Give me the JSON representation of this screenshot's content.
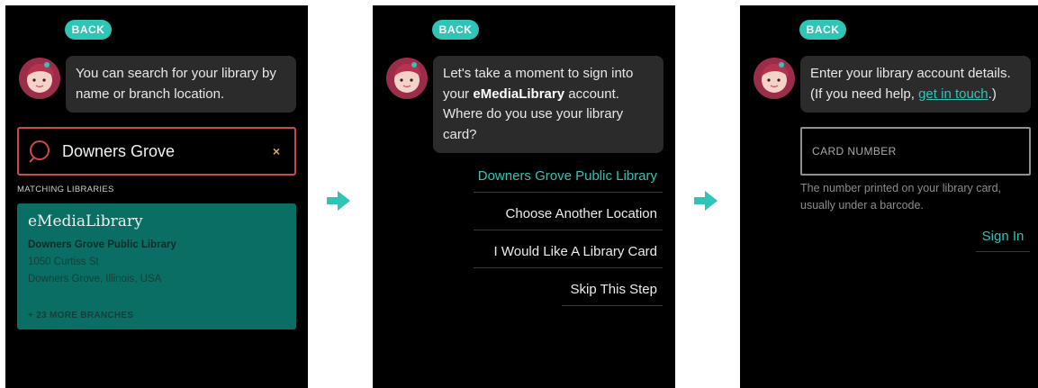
{
  "back_label": "BACK",
  "colors": {
    "accent": "#2ec4b6",
    "card": "#0b6e64",
    "error_border": "#d14848"
  },
  "screen1": {
    "bubble": "You can search for your library by name or branch location.",
    "search": {
      "value": "Downers Grove",
      "clear": "×"
    },
    "section_label": "MATCHING LIBRARIES",
    "card": {
      "brand": "eMediaLibrary",
      "name": "Downers Grove Public Library",
      "street": "1050 Curtiss St",
      "city": "Downers Grove, Illinois, USA",
      "more": "+ 23 MORE BRANCHES"
    }
  },
  "screen2": {
    "bubble_pre": "Let's take a moment to sign into your ",
    "bubble_bold": "eMediaLibrary",
    "bubble_post": " account. Where do you use your library card?",
    "options": [
      "Downers Grove Public Library",
      "Choose Another Location",
      "I Would Like A Library Card",
      "Skip This Step"
    ]
  },
  "screen3": {
    "bubble_pre": "Enter your library account details. (If you need help, ",
    "bubble_link": "get in touch",
    "bubble_post": ".)",
    "card_placeholder": "CARD NUMBER",
    "help": "The number printed on your library card, usually under a barcode.",
    "sign_in": "Sign In"
  },
  "icons": [
    "avatar-icon",
    "search-icon",
    "close-icon",
    "arrow-right-icon"
  ]
}
